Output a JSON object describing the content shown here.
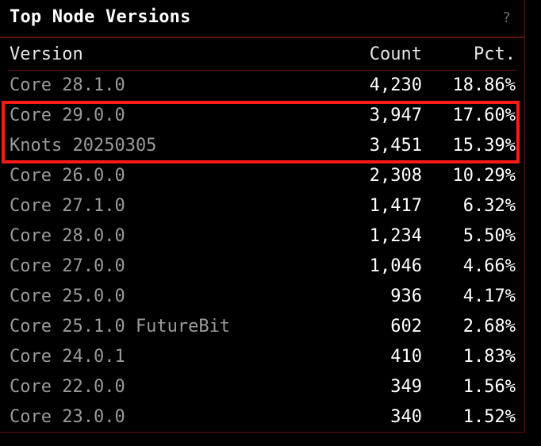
{
  "panel": {
    "title": "Top Node Versions",
    "help_label": "?",
    "help_icon": "question-mark-icon"
  },
  "table": {
    "columns": {
      "version": "Version",
      "count": "Count",
      "pct": "Pct."
    },
    "rows": [
      {
        "version": "Core 28.1.0",
        "count": "4,230",
        "pct": "18.86%"
      },
      {
        "version": "Core 29.0.0",
        "count": "3,947",
        "pct": "17.60%"
      },
      {
        "version": "Knots 20250305",
        "count": "3,451",
        "pct": "15.39%"
      },
      {
        "version": "Core 26.0.0",
        "count": "2,308",
        "pct": "10.29%"
      },
      {
        "version": "Core 27.1.0",
        "count": "1,417",
        "pct": "6.32%"
      },
      {
        "version": "Core 28.0.0",
        "count": "1,234",
        "pct": "5.50%"
      },
      {
        "version": "Core 27.0.0",
        "count": "1,046",
        "pct": "4.66%"
      },
      {
        "version": "Core 25.0.0",
        "count": "936",
        "pct": "4.17%"
      },
      {
        "version": "Core 25.1.0 FutureBit",
        "count": "602",
        "pct": "2.68%"
      },
      {
        "version": "Core 24.0.1",
        "count": "410",
        "pct": "1.83%"
      },
      {
        "version": "Core 22.0.0",
        "count": "349",
        "pct": "1.56%"
      },
      {
        "version": "Core 23.0.0",
        "count": "340",
        "pct": "1.52%"
      }
    ]
  },
  "colors": {
    "background": "#000000",
    "version_text": "#9a9a9a",
    "value_text": "#ffffff",
    "border": "#5a1212",
    "highlight": "#ff1a1a"
  }
}
